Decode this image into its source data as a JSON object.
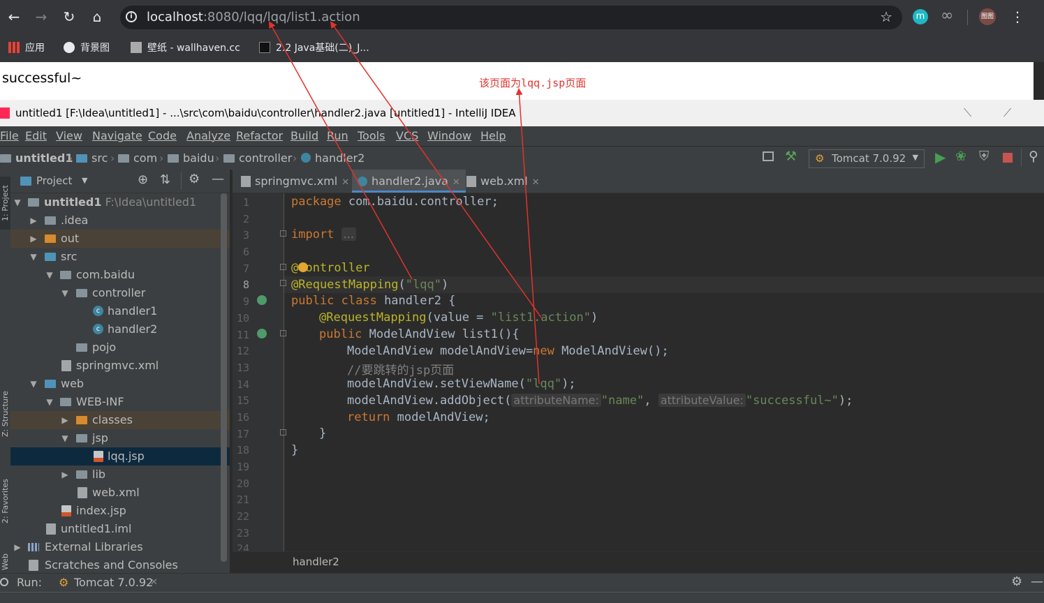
{
  "browser": {
    "url_host": "localhost",
    "url_path": ":8080/lqq/lqq/list1.action",
    "bookmarks": [
      {
        "label": "应用"
      },
      {
        "label": "背景图"
      },
      {
        "label": "壁纸 - wallhaven.cc"
      },
      {
        "label": "2.2 Java基础(二)_J..."
      }
    ],
    "profile_label": "图图"
  },
  "webpage": {
    "body_text": "successful~"
  },
  "annotation": {
    "text": "该页面为lqq.jsp页面"
  },
  "ide": {
    "title": "untitled1 [F:\\Idea\\untitled1] - ...\\src\\com\\baidu\\controller\\handler2.java [untitled1] - IntelliJ IDEA",
    "menu": [
      "File",
      "Edit",
      "View",
      "Navigate",
      "Code",
      "Analyze",
      "Refactor",
      "Build",
      "Run",
      "Tools",
      "VCS",
      "Window",
      "Help"
    ],
    "breadcrumb": [
      "untitled1",
      "src",
      "com",
      "baidu",
      "controller",
      "handler2"
    ],
    "run_config": "Tomcat 7.0.92",
    "project_panel_title": "Project",
    "side_tabs": [
      "1: Project",
      "Z: Structure",
      "2: Favorites",
      "Web"
    ],
    "tree": [
      {
        "label": "untitled1",
        "sub": "F:\\Idea\\untitled1"
      },
      {
        "label": ".idea"
      },
      {
        "label": "out"
      },
      {
        "label": "src"
      },
      {
        "label": "com.baidu"
      },
      {
        "label": "controller"
      },
      {
        "label": "handler1"
      },
      {
        "label": "handler2"
      },
      {
        "label": "pojo"
      },
      {
        "label": "springmvc.xml"
      },
      {
        "label": "web"
      },
      {
        "label": "WEB-INF"
      },
      {
        "label": "classes"
      },
      {
        "label": "jsp"
      },
      {
        "label": "lqq.jsp"
      },
      {
        "label": "lib"
      },
      {
        "label": "web.xml"
      },
      {
        "label": "index.jsp"
      },
      {
        "label": "untitled1.iml"
      },
      {
        "label": "External Libraries"
      },
      {
        "label": "Scratches and Consoles"
      }
    ],
    "tabs": [
      "springmvc.xml",
      "handler2.java",
      "web.xml"
    ],
    "line_numbers": [
      "1",
      "2",
      "3",
      "6",
      "7",
      "8",
      "9",
      "10",
      "11",
      "12",
      "13",
      "14",
      "15",
      "16",
      "17",
      "18",
      "19",
      "20",
      "21",
      "22",
      "23",
      "24"
    ],
    "code": {
      "l1_kw": "package",
      "l1_rest": " com.baidu.controller;",
      "l3_kw": "import",
      "l3_fold": "...",
      "l7": "@Controller",
      "l8_an": "@RequestMapping",
      "l8_str": "\"lqq\"",
      "l9_kw": "public class",
      "l9_rest": " handler2 {",
      "l10_an": "@RequestMapping",
      "l10_mid": "(value = ",
      "l10_str": "\"list1.action\"",
      "l11_kw": "public",
      "l11_rest": " ModelAndView list1(){",
      "l12_a": "ModelAndView modelAndView=",
      "l12_kw": "new",
      "l12_b": " ModelAndView();",
      "l13": "//要跳转的jsp页面",
      "l14_a": "modelAndView.setViewName(",
      "l14_str": "\"lqq\"",
      "l15_a": "modelAndView.addObject(",
      "l15_hint1": "attributeName:",
      "l15_str1": "\"name\"",
      "l15_hint2": "attributeValue:",
      "l15_str2": "\"successful~\"",
      "l16_kw": "return",
      "l16_rest": " modelAndView;",
      "l17": "}",
      "l18": "}"
    },
    "editor_footer": "handler2",
    "run_label": "Run:",
    "run_tab": "Tomcat 7.0.92"
  },
  "colors": {
    "arrow": "#e0332d",
    "keyword": "#cc7832",
    "annotation": "#bbb529",
    "string": "#6a8759"
  }
}
